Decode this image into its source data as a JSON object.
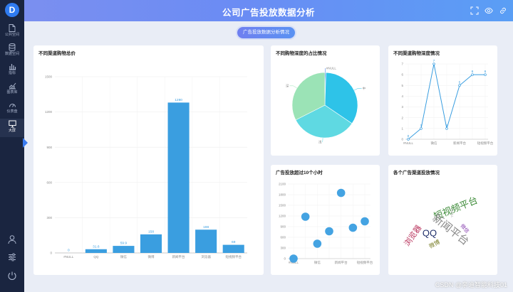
{
  "app": {
    "logo_letter": "D",
    "title": "公司广告投放数据分析"
  },
  "sidebar": {
    "items": [
      {
        "label": "公共空间",
        "icon": "document-icon"
      },
      {
        "label": "数据空间",
        "icon": "database-icon"
      },
      {
        "label": "指标",
        "icon": "bar-chart-icon"
      },
      {
        "label": "图表库",
        "icon": "chart-library-icon"
      },
      {
        "label": "仪表盘",
        "icon": "gauge-icon"
      },
      {
        "label": "大屏",
        "icon": "monitor-icon"
      }
    ],
    "active": "大屏",
    "bottom_icons": [
      "user-icon",
      "sliders-icon",
      "power-icon"
    ]
  },
  "header_icons": [
    "fullscreen-icon",
    "eye-icon",
    "link-icon"
  ],
  "section_pill": "广告投放数据分析情况",
  "cards": {
    "bar_title": "不同渠道购物总价",
    "pie_title": "不同购物深度的占比情况",
    "line_title": "不同渠道购物深度情况",
    "scatter_title": "广告投放超过10个小时",
    "cloud_title": "各个广告渠道投放情况"
  },
  "chart_data": [
    {
      "type": "bar",
      "title": "不同渠道购物总价",
      "categories": [
        "#NULL",
        "QQ",
        "微信",
        "微博",
        "新闻平台",
        "浏览器",
        "短视频平台"
      ],
      "values": [
        0,
        31.6,
        59.9,
        158,
        1280,
        198,
        69
      ],
      "ylim": [
        0,
        1500
      ],
      "yticks": [
        0,
        300,
        600,
        900,
        1200,
        1500
      ],
      "color": "#3a9ee0"
    },
    {
      "type": "pie",
      "title": "不同购物深度的占比情况",
      "labels": [
        "#NULL",
        "中",
        "浅",
        "深"
      ],
      "values": [
        0.5,
        34,
        33,
        32.5
      ],
      "colors": [
        "#2f6fe0",
        "#2ec3e8",
        "#5fd9e2",
        "#9be3b6"
      ]
    },
    {
      "type": "line",
      "title": "不同渠道购物深度情况",
      "categories": [
        "#NULL",
        "QQ",
        "微信",
        "微博",
        "新闻平台",
        "浏览器",
        "短视频平台"
      ],
      "values": [
        0,
        1,
        7,
        1,
        5,
        6,
        6
      ],
      "tick_labels": [
        "#NULL",
        "",
        "微信",
        "",
        "新闻平台",
        "",
        "短视频平台"
      ],
      "ylim": [
        0,
        7
      ],
      "yticks": [
        0,
        1,
        2,
        3,
        4,
        5,
        6,
        7
      ],
      "color": "#3a9ee0"
    },
    {
      "type": "scatter",
      "title": "广告投放超过10个小时",
      "categories": [
        "#NULL",
        "QQ",
        "微信",
        "微博",
        "新闻平台",
        "浏览器",
        "短视频平台"
      ],
      "tick_labels": [
        "#NULL",
        "",
        "微信",
        "",
        "新闻平台",
        "",
        "短视频平台"
      ],
      "values": [
        0,
        1180,
        420,
        770,
        1850,
        870,
        1050
      ],
      "ylim": [
        0,
        2100
      ],
      "yticks": [
        0,
        300,
        600,
        900,
        1200,
        1500,
        1800,
        2100
      ],
      "color": "#3a9ee0"
    },
    {
      "type": "wordcloud",
      "title": "各个广告渠道投放情况",
      "words": [
        {
          "text": "短视频平台",
          "color": "#3f8c3a"
        },
        {
          "text": "新闻平台",
          "color": "#8a8a8a"
        },
        {
          "text": "浏览器",
          "color": "#b8325b"
        },
        {
          "text": "QQ",
          "color": "#20306b"
        },
        {
          "text": "微信",
          "color": "#8a44b0"
        },
        {
          "text": "微博",
          "color": "#7a7f2a"
        },
        {
          "text": "#NULL",
          "color": "#9a9a9a"
        }
      ]
    }
  ],
  "watermark": "CSDN @亲迪智能科技01"
}
